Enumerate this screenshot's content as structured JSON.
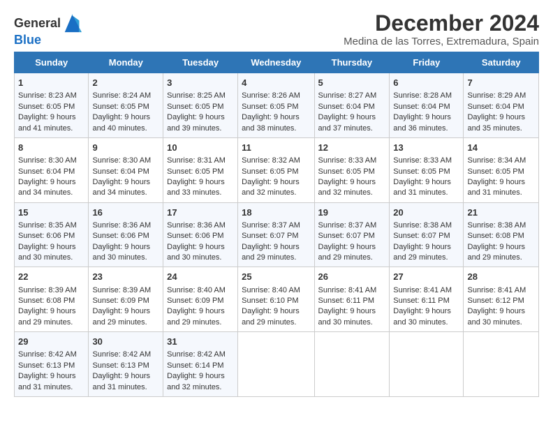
{
  "logo": {
    "text_general": "General",
    "text_blue": "Blue"
  },
  "title": "December 2024",
  "subtitle": "Medina de las Torres, Extremadura, Spain",
  "days_header": [
    "Sunday",
    "Monday",
    "Tuesday",
    "Wednesday",
    "Thursday",
    "Friday",
    "Saturday"
  ],
  "weeks": [
    [
      {
        "day": "1",
        "lines": [
          "Sunrise: 8:23 AM",
          "Sunset: 6:05 PM",
          "Daylight: 9 hours",
          "and 41 minutes."
        ]
      },
      {
        "day": "2",
        "lines": [
          "Sunrise: 8:24 AM",
          "Sunset: 6:05 PM",
          "Daylight: 9 hours",
          "and 40 minutes."
        ]
      },
      {
        "day": "3",
        "lines": [
          "Sunrise: 8:25 AM",
          "Sunset: 6:05 PM",
          "Daylight: 9 hours",
          "and 39 minutes."
        ]
      },
      {
        "day": "4",
        "lines": [
          "Sunrise: 8:26 AM",
          "Sunset: 6:05 PM",
          "Daylight: 9 hours",
          "and 38 minutes."
        ]
      },
      {
        "day": "5",
        "lines": [
          "Sunrise: 8:27 AM",
          "Sunset: 6:04 PM",
          "Daylight: 9 hours",
          "and 37 minutes."
        ]
      },
      {
        "day": "6",
        "lines": [
          "Sunrise: 8:28 AM",
          "Sunset: 6:04 PM",
          "Daylight: 9 hours",
          "and 36 minutes."
        ]
      },
      {
        "day": "7",
        "lines": [
          "Sunrise: 8:29 AM",
          "Sunset: 6:04 PM",
          "Daylight: 9 hours",
          "and 35 minutes."
        ]
      }
    ],
    [
      {
        "day": "8",
        "lines": [
          "Sunrise: 8:30 AM",
          "Sunset: 6:04 PM",
          "Daylight: 9 hours",
          "and 34 minutes."
        ]
      },
      {
        "day": "9",
        "lines": [
          "Sunrise: 8:30 AM",
          "Sunset: 6:04 PM",
          "Daylight: 9 hours",
          "and 34 minutes."
        ]
      },
      {
        "day": "10",
        "lines": [
          "Sunrise: 8:31 AM",
          "Sunset: 6:05 PM",
          "Daylight: 9 hours",
          "and 33 minutes."
        ]
      },
      {
        "day": "11",
        "lines": [
          "Sunrise: 8:32 AM",
          "Sunset: 6:05 PM",
          "Daylight: 9 hours",
          "and 32 minutes."
        ]
      },
      {
        "day": "12",
        "lines": [
          "Sunrise: 8:33 AM",
          "Sunset: 6:05 PM",
          "Daylight: 9 hours",
          "and 32 minutes."
        ]
      },
      {
        "day": "13",
        "lines": [
          "Sunrise: 8:33 AM",
          "Sunset: 6:05 PM",
          "Daylight: 9 hours",
          "and 31 minutes."
        ]
      },
      {
        "day": "14",
        "lines": [
          "Sunrise: 8:34 AM",
          "Sunset: 6:05 PM",
          "Daylight: 9 hours",
          "and 31 minutes."
        ]
      }
    ],
    [
      {
        "day": "15",
        "lines": [
          "Sunrise: 8:35 AM",
          "Sunset: 6:06 PM",
          "Daylight: 9 hours",
          "and 30 minutes."
        ]
      },
      {
        "day": "16",
        "lines": [
          "Sunrise: 8:36 AM",
          "Sunset: 6:06 PM",
          "Daylight: 9 hours",
          "and 30 minutes."
        ]
      },
      {
        "day": "17",
        "lines": [
          "Sunrise: 8:36 AM",
          "Sunset: 6:06 PM",
          "Daylight: 9 hours",
          "and 30 minutes."
        ]
      },
      {
        "day": "18",
        "lines": [
          "Sunrise: 8:37 AM",
          "Sunset: 6:07 PM",
          "Daylight: 9 hours",
          "and 29 minutes."
        ]
      },
      {
        "day": "19",
        "lines": [
          "Sunrise: 8:37 AM",
          "Sunset: 6:07 PM",
          "Daylight: 9 hours",
          "and 29 minutes."
        ]
      },
      {
        "day": "20",
        "lines": [
          "Sunrise: 8:38 AM",
          "Sunset: 6:07 PM",
          "Daylight: 9 hours",
          "and 29 minutes."
        ]
      },
      {
        "day": "21",
        "lines": [
          "Sunrise: 8:38 AM",
          "Sunset: 6:08 PM",
          "Daylight: 9 hours",
          "and 29 minutes."
        ]
      }
    ],
    [
      {
        "day": "22",
        "lines": [
          "Sunrise: 8:39 AM",
          "Sunset: 6:08 PM",
          "Daylight: 9 hours",
          "and 29 minutes."
        ]
      },
      {
        "day": "23",
        "lines": [
          "Sunrise: 8:39 AM",
          "Sunset: 6:09 PM",
          "Daylight: 9 hours",
          "and 29 minutes."
        ]
      },
      {
        "day": "24",
        "lines": [
          "Sunrise: 8:40 AM",
          "Sunset: 6:09 PM",
          "Daylight: 9 hours",
          "and 29 minutes."
        ]
      },
      {
        "day": "25",
        "lines": [
          "Sunrise: 8:40 AM",
          "Sunset: 6:10 PM",
          "Daylight: 9 hours",
          "and 29 minutes."
        ]
      },
      {
        "day": "26",
        "lines": [
          "Sunrise: 8:41 AM",
          "Sunset: 6:11 PM",
          "Daylight: 9 hours",
          "and 30 minutes."
        ]
      },
      {
        "day": "27",
        "lines": [
          "Sunrise: 8:41 AM",
          "Sunset: 6:11 PM",
          "Daylight: 9 hours",
          "and 30 minutes."
        ]
      },
      {
        "day": "28",
        "lines": [
          "Sunrise: 8:41 AM",
          "Sunset: 6:12 PM",
          "Daylight: 9 hours",
          "and 30 minutes."
        ]
      }
    ],
    [
      {
        "day": "29",
        "lines": [
          "Sunrise: 8:42 AM",
          "Sunset: 6:13 PM",
          "Daylight: 9 hours",
          "and 31 minutes."
        ]
      },
      {
        "day": "30",
        "lines": [
          "Sunrise: 8:42 AM",
          "Sunset: 6:13 PM",
          "Daylight: 9 hours",
          "and 31 minutes."
        ]
      },
      {
        "day": "31",
        "lines": [
          "Sunrise: 8:42 AM",
          "Sunset: 6:14 PM",
          "Daylight: 9 hours",
          "and 32 minutes."
        ]
      },
      null,
      null,
      null,
      null
    ]
  ]
}
